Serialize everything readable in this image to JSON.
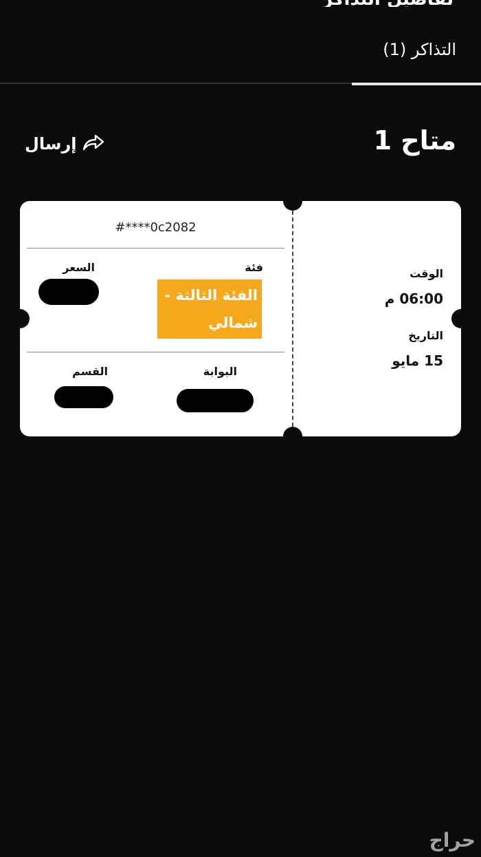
{
  "header": {
    "cut_title": "تفاصيل التذاكر"
  },
  "tabs": {
    "active_label": "التذاكر (1)"
  },
  "seat": {
    "title": "متاح 1"
  },
  "actions": {
    "send_label": "إرسال",
    "send_icon": "share-arrow-icon"
  },
  "ticket": {
    "id": "#****0c2082",
    "category_label": "فئة",
    "category_value": "الفئة الثالثة - شمالي",
    "price_label": "السعر",
    "gate_label": "البوابة",
    "section_label": "القسم",
    "time_label": "الوقت",
    "time_value": "06:00 م",
    "date_label": "التاريخ",
    "date_value": "15 مايو"
  },
  "watermark": {
    "text": "حراج"
  },
  "colors": {
    "background": "#0b0b0d",
    "ticket": "#ffffff",
    "category_highlight": "#f5a81c"
  }
}
